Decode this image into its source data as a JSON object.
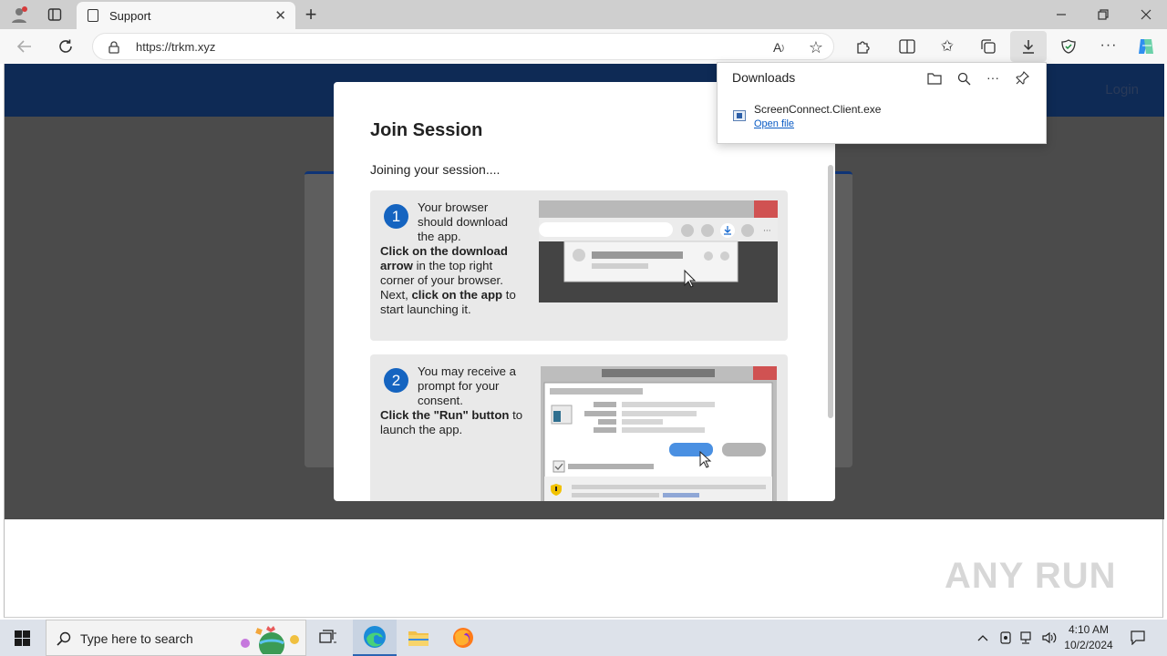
{
  "browser": {
    "tab_title": "Support",
    "url": "https://trkm.xyz"
  },
  "site": {
    "login_label": "Login"
  },
  "modal": {
    "title": "Join Session",
    "subtitle": "Joining your session....",
    "steps": [
      {
        "number": "1",
        "text_1": "Your browser should download the app.",
        "bold_1": "Click on the download arrow",
        "text_2": "in the top right corner of your browser. Next,",
        "bold_2": "click on the app",
        "text_3": "to start launching it."
      },
      {
        "number": "2",
        "text_1": "You may receive a prompt for your consent.",
        "bold_1": "Click the \"Run\" button",
        "text_2": "to launch the app."
      }
    ]
  },
  "downloads": {
    "title": "Downloads",
    "file_name": "ScreenConnect.Client.exe",
    "open_label": "Open file"
  },
  "taskbar": {
    "search_placeholder": "Type here to search",
    "time": "4:10 AM",
    "date": "10/2/2024"
  },
  "watermark": "ANY RUN",
  "colors": {
    "header": "#0e2a55",
    "step_badge": "#1564c0",
    "link": "#0a5bc4"
  }
}
